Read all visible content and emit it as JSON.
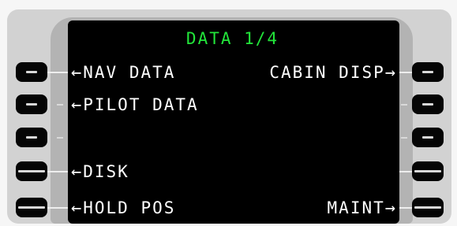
{
  "page": {
    "title": "DATA 1/4"
  },
  "left_prompts": [
    {
      "text": "NAV DATA",
      "arrow": "←"
    },
    {
      "text": "PILOT DATA",
      "arrow": "←"
    },
    {
      "text": "",
      "arrow": ""
    },
    {
      "text": "DISK",
      "arrow": "←"
    },
    {
      "text": "HOLD POS",
      "arrow": "←"
    }
  ],
  "right_prompts": [
    {
      "text": "CABIN DISP",
      "arrow": "→"
    },
    {
      "text": "",
      "arrow": ""
    },
    {
      "text": "",
      "arrow": ""
    },
    {
      "text": "",
      "arrow": ""
    },
    {
      "text": "MAINT",
      "arrow": "→"
    }
  ],
  "colors": {
    "title": "#22e53a",
    "prompt_text": "#ffffff",
    "screen_bg": "#000000"
  }
}
